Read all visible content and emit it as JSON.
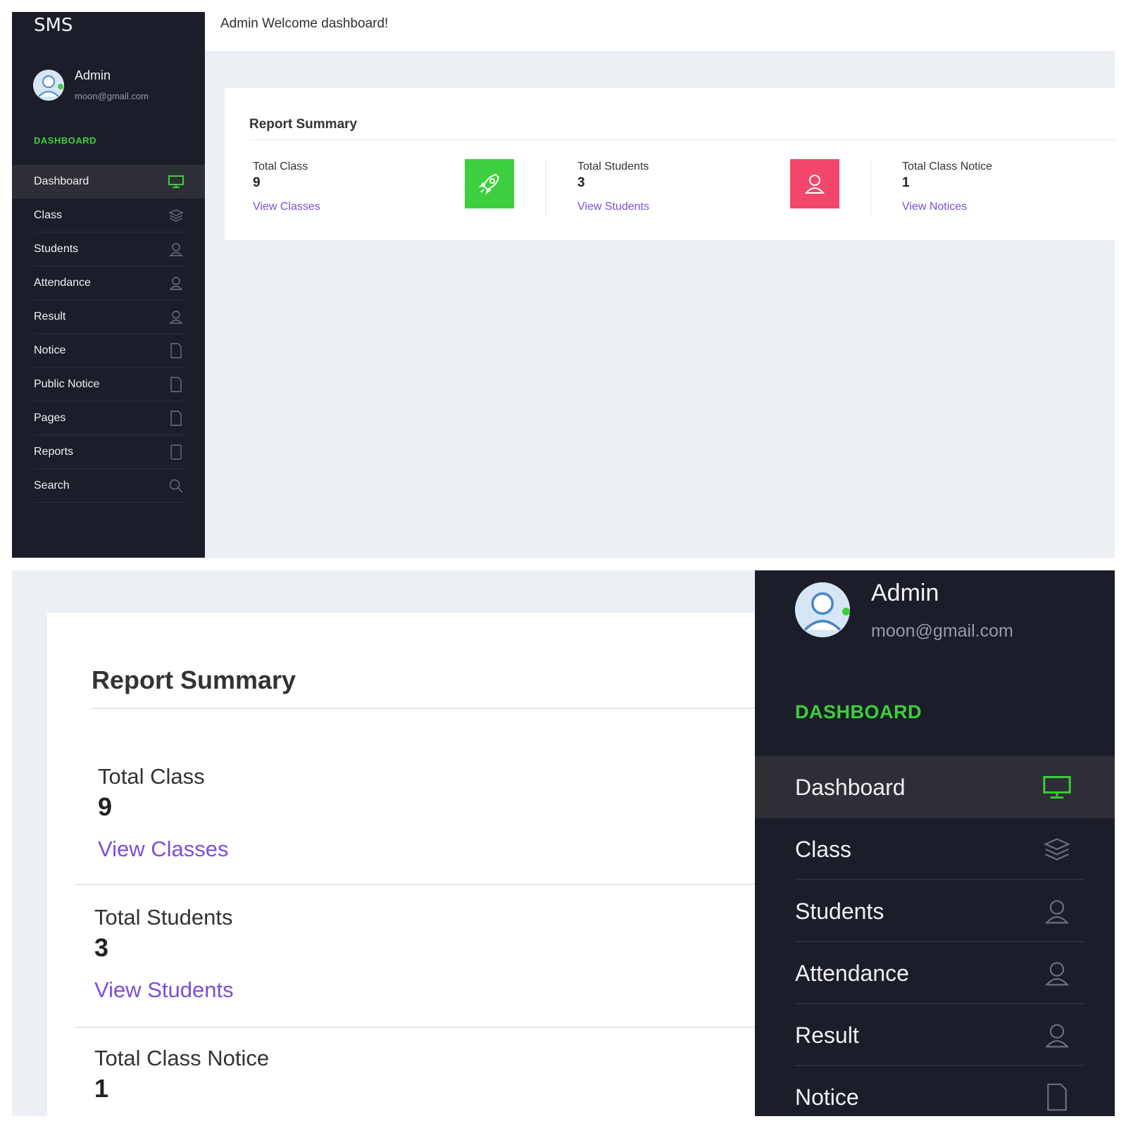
{
  "app": {
    "brand": "SMS"
  },
  "header": {
    "welcome": "Admin Welcome dashboard!"
  },
  "user": {
    "name": "Admin",
    "email": "moon@gmail.com"
  },
  "sidebar": {
    "section": "DASHBOARD",
    "items": [
      {
        "label": "Dashboard",
        "icon": "monitor-icon",
        "active": true
      },
      {
        "label": "Class",
        "icon": "layers-icon"
      },
      {
        "label": "Students",
        "icon": "user-icon"
      },
      {
        "label": "Attendance",
        "icon": "user-icon"
      },
      {
        "label": "Result",
        "icon": "user-icon"
      },
      {
        "label": "Notice",
        "icon": "file-icon"
      },
      {
        "label": "Public Notice",
        "icon": "file-icon"
      },
      {
        "label": "Pages",
        "icon": "file-icon"
      },
      {
        "label": "Reports",
        "icon": "tablet-icon"
      },
      {
        "label": "Search",
        "icon": "search-icon"
      }
    ]
  },
  "report": {
    "title": "Report Summary",
    "stats": [
      {
        "label": "Total Class",
        "value": "9",
        "link": "View Classes",
        "icon": "rocket-icon",
        "color": "#3ecf3e"
      },
      {
        "label": "Total Students",
        "value": "3",
        "link": "View Students",
        "icon": "user-icon",
        "color": "#f2476b"
      },
      {
        "label": "Total Class Notice",
        "value": "1",
        "link": "View Notices"
      }
    ]
  },
  "colors": {
    "sidebar_bg": "#1b1d29",
    "accent_green": "#3bd03b",
    "link_purple": "#7a4fd6",
    "content_bg": "#eceff4"
  }
}
